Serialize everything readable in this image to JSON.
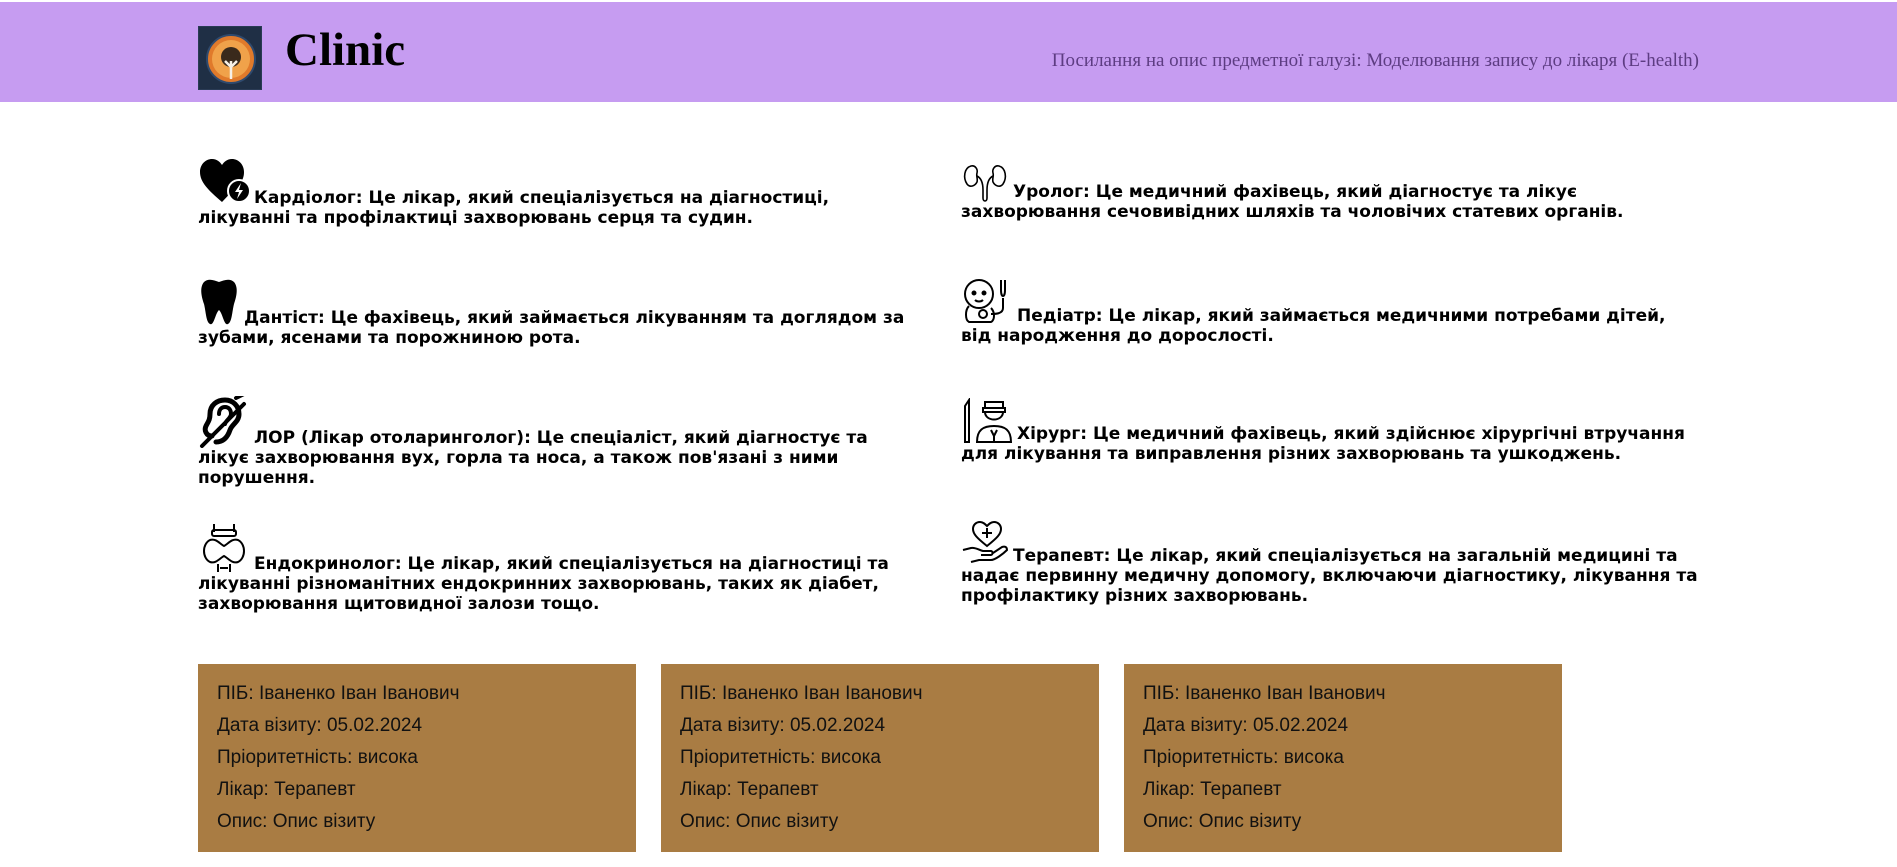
{
  "header": {
    "title": "Clinic",
    "logo": "tree-logo-icon",
    "link_text": "Посилання на опис предметної галузі: Моделювання запису до лікаря (E-health)",
    "background_color": "#c69cf1"
  },
  "specialists": [
    {
      "icon": "heart-icon",
      "name": "Кардіолог:",
      "text": "Це лікар, який спеціалізується на діагностиці, лікуванні та профілактиці захворювань серця та судин."
    },
    {
      "icon": "tooth-icon",
      "name": "Дантіст:",
      "text": "Це фахівець, який займається лікуванням та доглядом за зубами, ясенами та порожниною рота."
    },
    {
      "icon": "ear-icon",
      "name": "ЛОР (Лікар отоларинголог):",
      "text": "Це спеціаліст, який діагностує та лікує захворювання вух, горла та носа, а також пов'язані з ними порушення."
    },
    {
      "icon": "thyroid-icon",
      "name": "Ендокринолог:",
      "text": "Це лікар, який спеціалізується на діагностиці та лікуванні різноманітних ендокринних захворювань, таких як діабет, захворювання щитовидної залози тощо."
    },
    {
      "icon": "kidneys-icon",
      "name": "Уролог:",
      "text": "Це медичний фахівець, який діагностує та лікує захворювання сечовивідних шляхів та чоловічих статевих органів."
    },
    {
      "icon": "baby-stethoscope-icon",
      "name": "Педіатр:",
      "text": "Це лікар, який займається медичними потребами дітей, від народження до дорослості."
    },
    {
      "icon": "surgeon-icon",
      "name": "Хірург:",
      "text": "Це медичний фахівець, який здійснює хірургічні втручання для лікування та виправлення різних захворювань та ушкоджень."
    },
    {
      "icon": "heart-hand-icon",
      "name": "Терапевт:",
      "text": "Це лікар, який спеціалізується на загальній медицині та надає первинну медичну допомогу, включаючи діагностику, лікування та профілактику різних захворювань."
    }
  ],
  "visits": [
    {
      "name": "ПІБ: Іваненко Іван Іванович",
      "date": "Дата візиту: 05.02.2024",
      "priority": "Пріоритетність: висока",
      "doctor": "Лікар: Терапевт",
      "description": "Опис: Опис візиту"
    },
    {
      "name": "ПІБ: Іваненко Іван Іванович",
      "date": "Дата візиту: 05.02.2024",
      "priority": "Пріоритетність: висока",
      "doctor": "Лікар: Терапевт",
      "description": "Опис: Опис візиту"
    },
    {
      "name": "ПІБ: Іваненко Іван Іванович",
      "date": "Дата візиту: 05.02.2024",
      "priority": "Пріоритетність: висока",
      "doctor": "Лікар: Терапевт",
      "description": "Опис: Опис візиту"
    }
  ],
  "card_color": "#a97c43"
}
